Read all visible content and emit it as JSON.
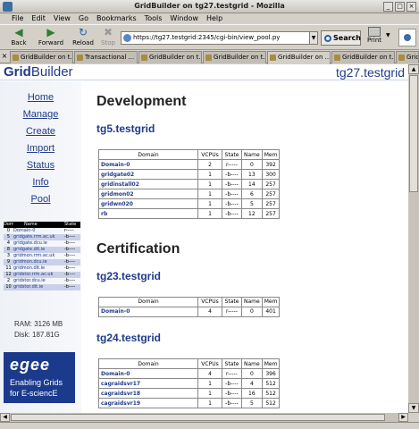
{
  "window": {
    "title": "GridBuilder on tg27.testgrid - Mozilla"
  },
  "menu": [
    "File",
    "Edit",
    "View",
    "Go",
    "Bookmarks",
    "Tools",
    "Window",
    "Help"
  ],
  "toolbar": {
    "back": "Back",
    "forward": "Forward",
    "reload": "Reload",
    "stop": "Stop",
    "url": "https://tg27.testgrid:2345/cgi-bin/view_pool.py",
    "search": "Search",
    "print": "Print"
  },
  "tabs": [
    "GridBuilder on t...",
    "Transactional ...",
    "GridBuilder on t...",
    "GridBuilder on t...",
    "GridBuilder on ...",
    "GridBuilder on t...",
    "GridBuilder on t..."
  ],
  "active_tab_index": 4,
  "header": {
    "logo_bold": "Grid",
    "logo_rest": "Builder",
    "host": "tg27.testgrid"
  },
  "sidebar": {
    "links": [
      "Home",
      "Manage",
      "Create",
      "Import",
      "Status",
      "Info",
      "Pool"
    ],
    "pool_table": {
      "headers": [
        "Domain",
        "Name",
        "State"
      ],
      "rows": [
        [
          "0",
          "Domain-0",
          "r-----"
        ],
        [
          "5",
          "gridgate.rrm.ac.uk",
          "-b----"
        ],
        [
          "4",
          "gridgate.dcu.ie",
          "-b----"
        ],
        [
          "8",
          "gridgate.dit.ie",
          "-b----"
        ],
        [
          "3",
          "gridmon.rrm.ac.uk",
          "-b----"
        ],
        [
          "9",
          "gridmon.dcu.ie",
          "-b----"
        ],
        [
          "11",
          "gridmon.dit.ie",
          "-b----"
        ],
        [
          "12",
          "gridstor.rrm.ac.uk",
          "-b----"
        ],
        [
          "2",
          "gridstor.dcu.ie",
          "-b----"
        ],
        [
          "10",
          "gridstor.dit.ie",
          "-b----"
        ]
      ]
    },
    "ram": "RAM: 3126 MB",
    "disk": "Disk: 187.81G",
    "egee": {
      "logo": "egee",
      "line1": "Enabling Grids",
      "line2": "for E-sciencE"
    }
  },
  "main": {
    "table_headers": [
      "Domain",
      "VCPUs",
      "State",
      "Name",
      "Mem"
    ],
    "sections": [
      {
        "title": "Development",
        "hosts": [
          {
            "name": "tg5.testgrid",
            "rows": [
              [
                "Domain-0",
                "2",
                "r-----",
                "0",
                "392"
              ],
              [
                "gridgate02",
                "1",
                "-b----",
                "13",
                "300"
              ],
              [
                "gridinstall02",
                "1",
                "-b----",
                "14",
                "257"
              ],
              [
                "gridmon02",
                "1",
                "-b----",
                "6",
                "257"
              ],
              [
                "gridwn020",
                "1",
                "-b----",
                "5",
                "257"
              ],
              [
                "rb",
                "1",
                "-b----",
                "12",
                "257"
              ]
            ]
          }
        ]
      },
      {
        "title": "Certification",
        "hosts": [
          {
            "name": "tg23.testgrid",
            "rows": [
              [
                "Domain-0",
                "4",
                "r-----",
                "0",
                "401"
              ]
            ]
          },
          {
            "name": "tg24.testgrid",
            "rows": [
              [
                "Domain-0",
                "4",
                "r-----",
                "0",
                "396"
              ],
              [
                "cagraidsvr17",
                "1",
                "-b----",
                "4",
                "512"
              ],
              [
                "cagraidsvr18",
                "1",
                "-b----",
                "16",
                "512"
              ],
              [
                "cagraidsvr19",
                "1",
                "-b----",
                "5",
                "512"
              ]
            ]
          }
        ]
      }
    ]
  }
}
